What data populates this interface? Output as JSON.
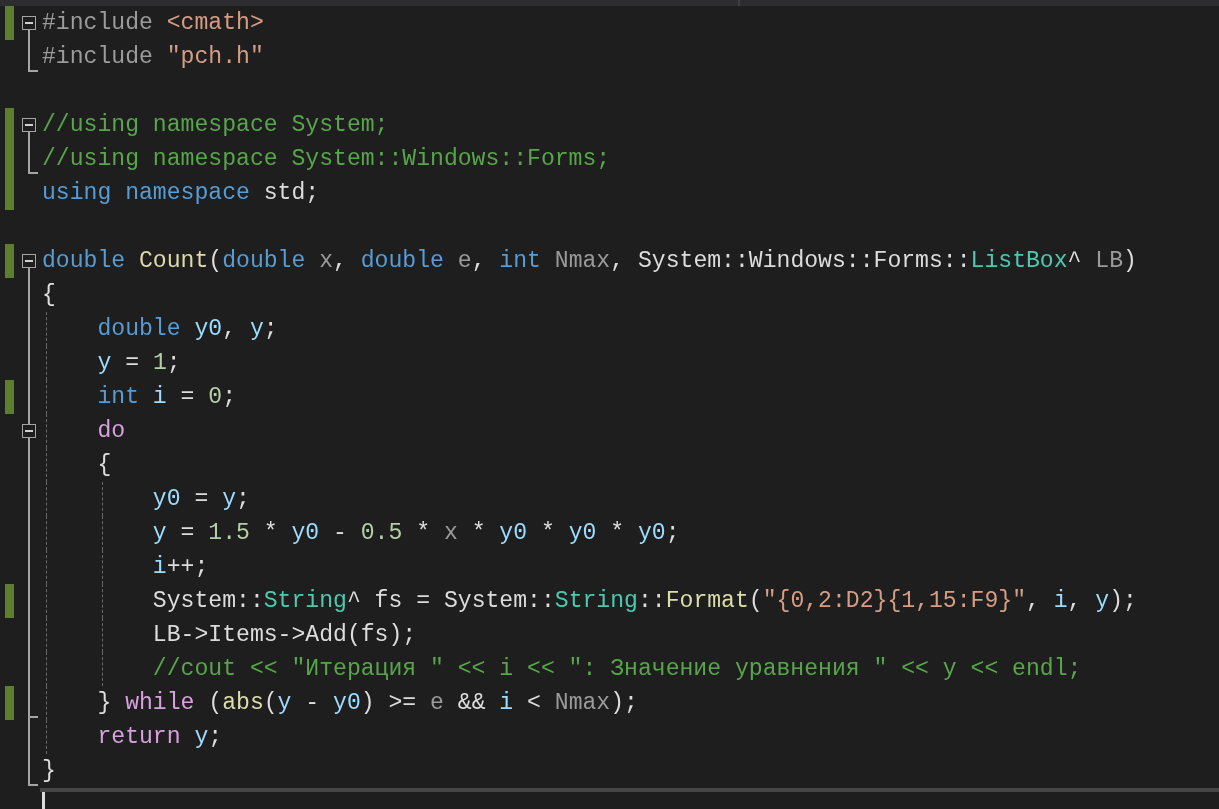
{
  "editor": {
    "lines": [
      {
        "changed": true,
        "fold_start": true,
        "fold_end": false,
        "in_block": false,
        "tokens": [
          {
            "text": "#include ",
            "kind": "preprocessor"
          },
          {
            "text": "<cmath>",
            "kind": "string"
          }
        ]
      },
      {
        "changed": false,
        "fold_start": false,
        "fold_end": true,
        "in_block": false,
        "tokens": [
          {
            "text": "#include ",
            "kind": "preprocessor"
          },
          {
            "text": "\"pch.h\"",
            "kind": "string"
          }
        ]
      },
      {
        "changed": false,
        "fold_start": false,
        "fold_end": false,
        "in_block": false
      },
      {
        "changed": true,
        "fold_start": true,
        "fold_end": false,
        "in_block": false,
        "tokens": [
          {
            "text": "//using namespace System;",
            "kind": "comment"
          }
        ]
      },
      {
        "changed": true,
        "fold_start": false,
        "fold_end": true,
        "in_block": false,
        "tokens": [
          {
            "text": "//using namespace System::Windows::Forms;",
            "kind": "comment"
          }
        ]
      },
      {
        "changed": true,
        "fold_start": false,
        "fold_end": false,
        "in_block": false,
        "tokens": [
          {
            "text": "using namespace",
            "kind": "keyword"
          },
          {
            "text": " std;",
            "kind": "plain"
          }
        ]
      },
      {
        "changed": false,
        "fold_start": false,
        "fold_end": false,
        "in_block": false
      },
      {
        "changed": true,
        "fold_start": true,
        "fold_end": false,
        "in_block": false,
        "tokens": [
          {
            "text": "double ",
            "kind": "keyword"
          },
          {
            "text": "Count",
            "kind": "function"
          },
          {
            "text": "(",
            "kind": "plain"
          },
          {
            "text": "double",
            "kind": "keyword"
          },
          {
            "text": " x",
            "kind": "parameter"
          },
          {
            "text": ", ",
            "kind": "plain"
          },
          {
            "text": "double",
            "kind": "keyword"
          },
          {
            "text": " e",
            "kind": "parameter"
          },
          {
            "text": ", ",
            "kind": "plain"
          },
          {
            "text": "int",
            "kind": "keyword"
          },
          {
            "text": " Nmax",
            "kind": "parameter"
          },
          {
            "text": ", System::Windows::Forms::",
            "kind": "plain"
          },
          {
            "text": "ListBox",
            "kind": "type"
          },
          {
            "text": "^ ",
            "kind": "plain"
          },
          {
            "text": "LB",
            "kind": "parameter"
          },
          {
            "text": ")",
            "kind": "plain"
          }
        ]
      },
      {
        "changed": false,
        "fold_start": false,
        "fold_end": false,
        "in_block": true,
        "tokens": [
          {
            "text": "{",
            "kind": "plain"
          }
        ]
      },
      {
        "changed": false,
        "fold_start": false,
        "fold_end": false,
        "in_block": true,
        "tokens": [
          {
            "text": "    double",
            "kind": "keyword"
          },
          {
            "text": " y0",
            "kind": "variable"
          },
          {
            "text": ", ",
            "kind": "plain"
          },
          {
            "text": "y",
            "kind": "variable"
          },
          {
            "text": ";",
            "kind": "plain"
          }
        ]
      },
      {
        "changed": false,
        "fold_start": false,
        "fold_end": false,
        "in_block": true,
        "tokens": [
          {
            "text": "    y",
            "kind": "variable"
          },
          {
            "text": " = ",
            "kind": "plain"
          },
          {
            "text": "1",
            "kind": "number"
          },
          {
            "text": ";",
            "kind": "plain"
          }
        ]
      },
      {
        "changed": true,
        "fold_start": false,
        "fold_end": false,
        "in_block": true,
        "tokens": [
          {
            "text": "    int",
            "kind": "keyword"
          },
          {
            "text": " i",
            "kind": "variable"
          },
          {
            "text": " = ",
            "kind": "plain"
          },
          {
            "text": "0",
            "kind": "number"
          },
          {
            "text": ";",
            "kind": "plain"
          }
        ]
      },
      {
        "changed": false,
        "fold_start": true,
        "fold_end": false,
        "in_block": true,
        "tokens": [
          {
            "text": "    do",
            "kind": "control"
          }
        ]
      },
      {
        "changed": false,
        "fold_start": false,
        "fold_end": false,
        "in_block": true,
        "tokens": [
          {
            "text": "    {",
            "kind": "plain"
          }
        ]
      },
      {
        "changed": false,
        "fold_start": false,
        "fold_end": false,
        "in_block": true,
        "tokens": [
          {
            "text": "        y0",
            "kind": "variable"
          },
          {
            "text": " = ",
            "kind": "plain"
          },
          {
            "text": "y",
            "kind": "variable"
          },
          {
            "text": ";",
            "kind": "plain"
          }
        ]
      },
      {
        "changed": false,
        "fold_start": false,
        "fold_end": false,
        "in_block": true,
        "tokens": [
          {
            "text": "        y",
            "kind": "variable"
          },
          {
            "text": " = ",
            "kind": "plain"
          },
          {
            "text": "1.5",
            "kind": "number"
          },
          {
            "text": " * ",
            "kind": "plain"
          },
          {
            "text": "y0",
            "kind": "variable"
          },
          {
            "text": " - ",
            "kind": "plain"
          },
          {
            "text": "0.5",
            "kind": "number"
          },
          {
            "text": " * ",
            "kind": "plain"
          },
          {
            "text": "x",
            "kind": "parameter"
          },
          {
            "text": " * ",
            "kind": "plain"
          },
          {
            "text": "y0",
            "kind": "variable"
          },
          {
            "text": " * ",
            "kind": "plain"
          },
          {
            "text": "y0",
            "kind": "variable"
          },
          {
            "text": " * ",
            "kind": "plain"
          },
          {
            "text": "y0",
            "kind": "variable"
          },
          {
            "text": ";",
            "kind": "plain"
          }
        ]
      },
      {
        "changed": false,
        "fold_start": false,
        "fold_end": false,
        "in_block": true,
        "tokens": [
          {
            "text": "        i",
            "kind": "variable"
          },
          {
            "text": "++;",
            "kind": "plain"
          }
        ]
      },
      {
        "changed": true,
        "fold_start": false,
        "fold_end": false,
        "in_block": true,
        "tokens": [
          {
            "text": "        System::",
            "kind": "plain"
          },
          {
            "text": "String",
            "kind": "type"
          },
          {
            "text": "^ fs = System::",
            "kind": "plain"
          },
          {
            "text": "String",
            "kind": "type"
          },
          {
            "text": "::",
            "kind": "plain"
          },
          {
            "text": "Format",
            "kind": "function"
          },
          {
            "text": "(",
            "kind": "plain"
          },
          {
            "text": "\"{0,2:D2}{1,15:F9}\"",
            "kind": "string"
          },
          {
            "text": ", ",
            "kind": "plain"
          },
          {
            "text": "i",
            "kind": "variable"
          },
          {
            "text": ", ",
            "kind": "plain"
          },
          {
            "text": "y",
            "kind": "variable"
          },
          {
            "text": ");",
            "kind": "plain"
          }
        ]
      },
      {
        "changed": false,
        "fold_start": false,
        "fold_end": false,
        "in_block": true,
        "tokens": [
          {
            "text": "        LB->Items->Add(fs);",
            "kind": "plain"
          }
        ]
      },
      {
        "changed": false,
        "fold_start": false,
        "fold_end": false,
        "in_block": true,
        "tokens": [
          {
            "text": "        //cout << \"Итерация \" << i << \": Значение уравнения \" << y << endl;",
            "kind": "comment"
          }
        ]
      },
      {
        "changed": true,
        "fold_start": false,
        "fold_end": true,
        "in_block": true,
        "tokens": [
          {
            "text": "    } ",
            "kind": "plain"
          },
          {
            "text": "while",
            "kind": "control"
          },
          {
            "text": " (",
            "kind": "plain"
          },
          {
            "text": "abs",
            "kind": "function"
          },
          {
            "text": "(",
            "kind": "plain"
          },
          {
            "text": "y",
            "kind": "variable"
          },
          {
            "text": " - ",
            "kind": "plain"
          },
          {
            "text": "y0",
            "kind": "variable"
          },
          {
            "text": ") >= ",
            "kind": "plain"
          },
          {
            "text": "e",
            "kind": "parameter"
          },
          {
            "text": " && ",
            "kind": "plain"
          },
          {
            "text": "i",
            "kind": "variable"
          },
          {
            "text": " < ",
            "kind": "plain"
          },
          {
            "text": "Nmax",
            "kind": "parameter"
          },
          {
            "text": ");",
            "kind": "plain"
          }
        ]
      },
      {
        "changed": false,
        "fold_start": false,
        "fold_end": false,
        "in_block": true,
        "tokens": [
          {
            "text": "    return ",
            "kind": "control"
          },
          {
            "text": "y",
            "kind": "variable"
          },
          {
            "text": ";",
            "kind": "plain"
          }
        ]
      },
      {
        "changed": false,
        "fold_start": false,
        "fold_end": true,
        "in_block": false,
        "tokens": [
          {
            "text": "}",
            "kind": "plain"
          }
        ]
      },
      {
        "changed": false,
        "fold_start": false,
        "fold_end": false,
        "in_block": false,
        "current": true
      }
    ]
  }
}
